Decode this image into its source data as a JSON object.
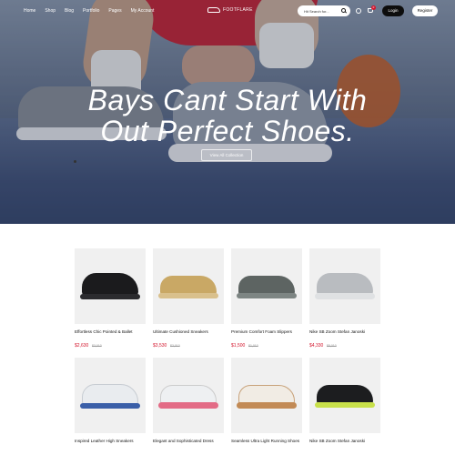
{
  "nav": {
    "menu": [
      "Home",
      "Shop",
      "Blog",
      "Portfolio",
      "Pages",
      "My Account"
    ],
    "logo_text": "FOOTFLARE",
    "search_placeholder": "Hit Search for...",
    "cart_count": "0",
    "login_label": "Login",
    "register_label": "Register"
  },
  "hero": {
    "headline_line1": "Bays Cant Start With",
    "headline_line2": "Out Perfect Shoes.",
    "cta_label": "View All Collection"
  },
  "products": [
    {
      "name": "Effortless Chic Pointed & Ballet",
      "price": "$2,630",
      "old_price": "$3,010",
      "color": "black"
    },
    {
      "name": "Ultimate Cushioned Sneakers",
      "price": "$3,530",
      "old_price": "$3,010",
      "color": "gold"
    },
    {
      "name": "Premium Comfort Foam Slippers",
      "price": "$1,500",
      "old_price": "$1,010",
      "color": "grey"
    },
    {
      "name": "Nike SB Zoom Stefan Janoski",
      "price": "$4,330",
      "old_price": "$5,010",
      "color": "silver"
    },
    {
      "name": "Inspired Leather High Sneakers",
      "price": "",
      "old_price": "",
      "color": "white-blue"
    },
    {
      "name": "Elegant and Sophisticated Dress",
      "price": "",
      "old_price": "",
      "color": "white-pink"
    },
    {
      "name": "Seamless Ultra Light Running Shoes",
      "price": "",
      "old_price": "",
      "color": "white-tan"
    },
    {
      "name": "Nike SB Zoom Stefan Janoski",
      "price": "",
      "old_price": "",
      "color": "black-volt"
    }
  ],
  "colors": {
    "accent_red": "#d3142b",
    "dark": "#0d0d0d",
    "card_bg": "#f0f0f0"
  }
}
